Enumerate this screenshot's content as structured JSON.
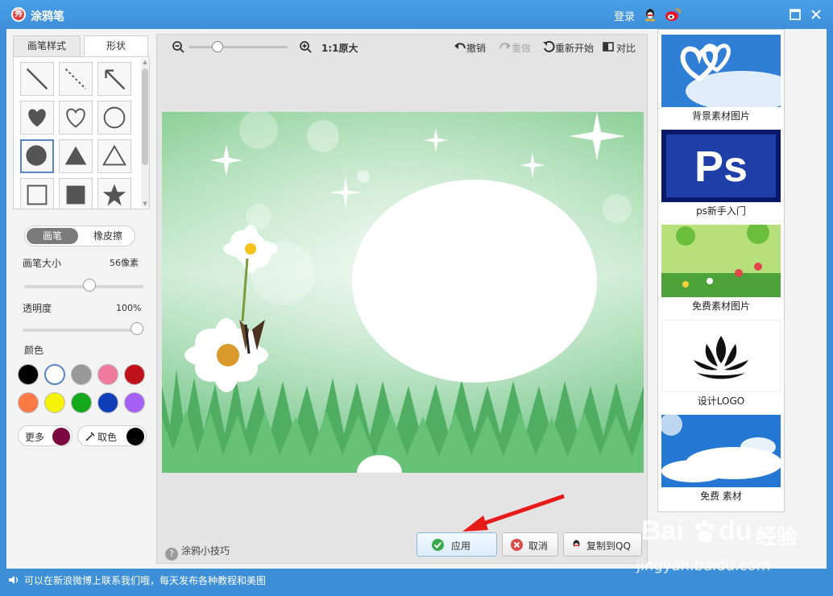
{
  "window": {
    "title": "涂鸦笔",
    "login": "登录",
    "app_icon_char": "秀"
  },
  "left": {
    "tabs": [
      "画笔样式",
      "形状"
    ],
    "mode": {
      "on": "画笔",
      "off": "橡皮擦"
    },
    "brush_size": {
      "label": "画笔大小",
      "value": "56像素",
      "level": 0.55
    },
    "opacity": {
      "label": "透明度",
      "value": "100%",
      "level": 1.0
    },
    "color_label": "颜色",
    "colors": [
      "#000000",
      "#ffffff",
      "#999999",
      "#f07aa0",
      "#c0101a",
      "#ff7a45",
      "#f7f20a",
      "#14a81c",
      "#0e3fb8",
      "#a561f5"
    ],
    "more_label": "更多",
    "more_color": "#7a0a40",
    "pick_label": "取色",
    "pick_color": "#000000"
  },
  "toolbar": {
    "zoom_label": "1:1原大",
    "undo": "撤销",
    "redo": "重做",
    "restart": "重新开始",
    "compare": "对比"
  },
  "bottom": {
    "tips": "涂鸦小技巧",
    "apply": "应用",
    "cancel": "取消",
    "copy": "复制到QQ"
  },
  "right": {
    "items": [
      {
        "caption": "背景素材图片",
        "icon": "heart-cloud-image"
      },
      {
        "caption": "ps新手入门",
        "icon": "photoshop-logo-image"
      },
      {
        "caption": "免费素材图片",
        "icon": "flower-field-image"
      },
      {
        "caption": "设计LOGO",
        "icon": "lotus-logo-image"
      },
      {
        "caption": "免费 素材",
        "icon": "blue-sky-image"
      }
    ],
    "ps_text": "Ps"
  },
  "status": {
    "text": "可以在新浪微博上联系我们哦，每天发布各种教程和美图"
  },
  "watermark": {
    "brand": "Bai",
    "brand_tail": "du",
    "brand_cn": "经验",
    "url": "jingyan.baidu.com"
  }
}
